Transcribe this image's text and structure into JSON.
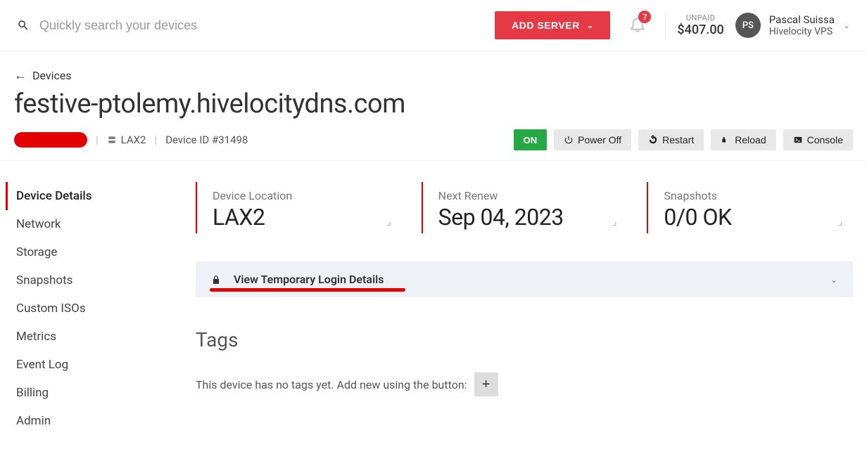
{
  "header": {
    "search_placeholder": "Quickly search your devices",
    "add_server_label": "ADD SERVER",
    "notification_count": "7",
    "unpaid_label": "UNPAID",
    "unpaid_amount": "$407.00",
    "user_initials": "PS",
    "user_name": "Pascal Suissa",
    "user_org": "Hivelocity VPS"
  },
  "breadcrumb": {
    "back_label": "Devices"
  },
  "device": {
    "title": "festive-ptolemy.hivelocitydns.com",
    "location_code": "LAX2",
    "id_label": "Device ID #31498"
  },
  "actions": {
    "status": "ON",
    "power_off": "Power Off",
    "restart": "Restart",
    "reload": "Reload",
    "console": "Console"
  },
  "sidebar": {
    "items": [
      "Device Details",
      "Network",
      "Storage",
      "Snapshots",
      "Custom ISOs",
      "Metrics",
      "Event Log",
      "Billing",
      "Admin"
    ],
    "active_index": 0
  },
  "cards": {
    "location": {
      "label": "Device Location",
      "value": "LAX2"
    },
    "renew": {
      "label": "Next Renew",
      "value": "Sep 04, 2023"
    },
    "snapshots": {
      "label": "Snapshots",
      "value": "0/0 OK"
    }
  },
  "login_panel": {
    "label": "View Temporary Login Details"
  },
  "tags": {
    "heading": "Tags",
    "empty_text": "This device has no tags yet. Add new using the button:"
  }
}
